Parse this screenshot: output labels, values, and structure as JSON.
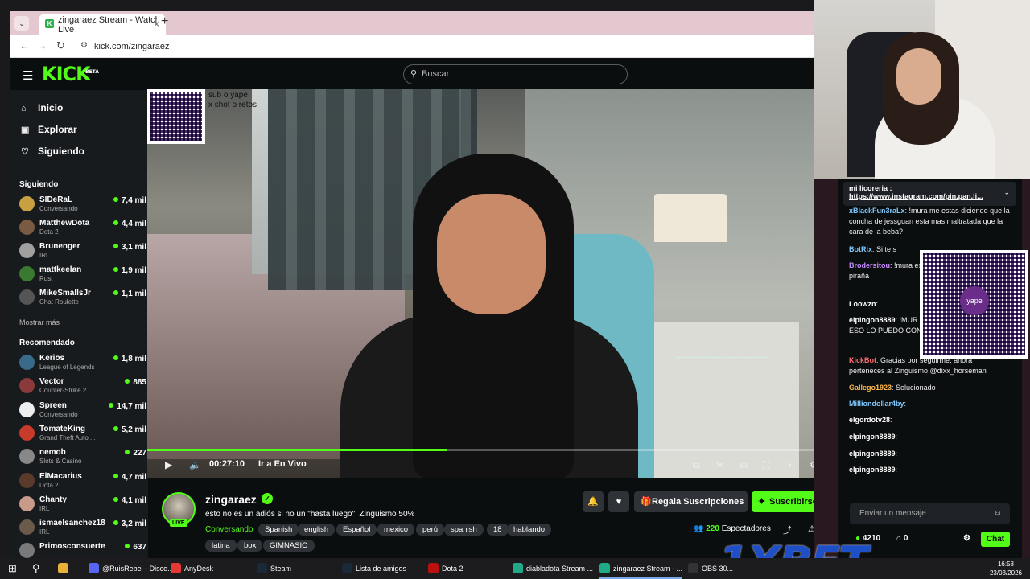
{
  "browser": {
    "tab_title": "zingaraez Stream - Watch Live",
    "url": "kick.com/zingaraez"
  },
  "header": {
    "logo": "KICK",
    "logo_badge": "BETA",
    "search_placeholder": "Buscar"
  },
  "nav": [
    {
      "label": "Inicio",
      "icon": "home-icon"
    },
    {
      "label": "Explorar",
      "icon": "explore-icon"
    },
    {
      "label": "Siguiendo",
      "icon": "heart-icon"
    }
  ],
  "following_title": "Siguiendo",
  "following": [
    {
      "name": "SIDeRaL",
      "game": "Conversando",
      "viewers": "7,4 mil",
      "color": "#c8a040"
    },
    {
      "name": "MatthewDota",
      "game": "Dota 2",
      "viewers": "4,4 mil",
      "color": "#7a5a40"
    },
    {
      "name": "Brunenger",
      "game": "IRL",
      "viewers": "3,1 mil",
      "color": "#a0a0a0"
    },
    {
      "name": "mattkeelan",
      "game": "Rust",
      "viewers": "1,9 mil",
      "color": "#3a7a30"
    },
    {
      "name": "MikeSmallsJr",
      "game": "Chat Roulette",
      "viewers": "1,1 mil",
      "color": "#555"
    }
  ],
  "show_more": "Mostrar más",
  "recommended_title": "Recomendado",
  "recommended": [
    {
      "name": "Kerios",
      "game": "League of Legends",
      "viewers": "1,8 mil",
      "color": "#3a6a8a"
    },
    {
      "name": "Vector",
      "game": "Counter-Strike 2",
      "viewers": "885",
      "color": "#8a3a3a"
    },
    {
      "name": "Spreen",
      "game": "Conversando",
      "viewers": "14,7 mil",
      "color": "#eee"
    },
    {
      "name": "TomateKing",
      "game": "Grand Theft Auto ...",
      "viewers": "5,2 mil",
      "color": "#c83a2a"
    },
    {
      "name": "nemob",
      "game": "Slots & Casino",
      "viewers": "227",
      "color": "#888"
    },
    {
      "name": "ElMacarius",
      "game": "Dota 2",
      "viewers": "4,7 mil",
      "color": "#5a3a2a"
    },
    {
      "name": "Chanty",
      "game": "IRL",
      "viewers": "4,1 mil",
      "color": "#c89a8a"
    },
    {
      "name": "ismaelsanchez18",
      "game": "IRL",
      "viewers": "3,2 mil",
      "color": "#6a5a4a"
    },
    {
      "name": "Primosconsuerte",
      "game": "",
      "viewers": "637",
      "color": "#7a7a7a"
    }
  ],
  "video": {
    "overlay_text": "sub o yape\nx shot o retos",
    "time": "00:27:10",
    "go_live": "Ir a En Vivo",
    "progress_fraction": 0.433
  },
  "stream": {
    "streamer": "zingaraez",
    "live": "LIVE",
    "title": "esto no es un adiós si no un \"hasta luego\"| Zinguismo 50%",
    "category": "Conversando",
    "tags": [
      "Spanish",
      "english",
      "Español",
      "mexico",
      "perú",
      "spanish",
      "18",
      "hablando",
      "latina",
      "box",
      "GIMNASIO"
    ],
    "viewers": "220",
    "viewers_label": "Espectadores",
    "gift_label": "Regala Suscripciones",
    "subscribe_label": "Suscribirse"
  },
  "chat": {
    "pinned_label": "mi licoreria :",
    "pinned_link": "https://www.instagram.com/pin.pan.li...",
    "messages": [
      {
        "user": "xBlackFun3raLx",
        "text": "!mura me estas diciendo que la concha de jessguan esta mas maltratada que la cara de la beba?",
        "color": "#7ec8ff"
      },
      {
        "user": "BotRix",
        "text": "Si te s",
        "color": "#7ec8ff"
      },
      {
        "user": "Brodersitou",
        "text": "!mura es paradora y ahora hab tal piraña",
        "color": "#c98aff"
      },
      {
        "user": "Loowzn",
        "text": "",
        "color": "#ffffff"
      },
      {
        "user": "elpingon8889",
        "text": "!MUR BRAQUES MASTICAN ESO LO PUEDO CON",
        "color": "#ffffff"
      },
      {
        "user": "KickBot",
        "text": "Gracias por seguirme, ahora perteneces al Zinguismo @dixx_horseman",
        "color": "#ff6a6a"
      },
      {
        "user": "Gallego1923",
        "text": "Solucionado",
        "color": "#ffb84a"
      },
      {
        "user": "Milliondollar4by",
        "text": "",
        "color": "#7ec8ff"
      },
      {
        "user": "elgordotv28",
        "text": "",
        "color": "#ffffff"
      },
      {
        "user": "elpingon8889",
        "text": "",
        "color": "#ffffff"
      },
      {
        "user": "elpingon8889",
        "text": "",
        "color": "#ffffff"
      },
      {
        "user": "elpingon8889",
        "text": "",
        "color": "#ffffff"
      }
    ],
    "input_placeholder": "Enviar un mensaje",
    "points": "4210",
    "count": "0",
    "send_label": "Chat"
  },
  "ad": {
    "brand": "1XBET",
    "qr_logo": "yape"
  },
  "taskbar": [
    {
      "label": "@RuisRebel - Disco...",
      "color": "#5865f2"
    },
    {
      "label": "AnyDesk",
      "color": "#e53935"
    },
    {
      "label": "Steam",
      "color": "#1b2838"
    },
    {
      "label": "Lista de amigos",
      "color": "#1b2838"
    },
    {
      "label": "Dota 2",
      "color": "#b11"
    },
    {
      "label": "diabladota Stream ...",
      "color": "#2a8"
    },
    {
      "label": "zingaraez Stream - ...",
      "color": "#2a8"
    },
    {
      "label": "OBS 30...",
      "color": "#333"
    }
  ],
  "clock": {
    "time": "16:58",
    "date": "23/03/2026"
  }
}
